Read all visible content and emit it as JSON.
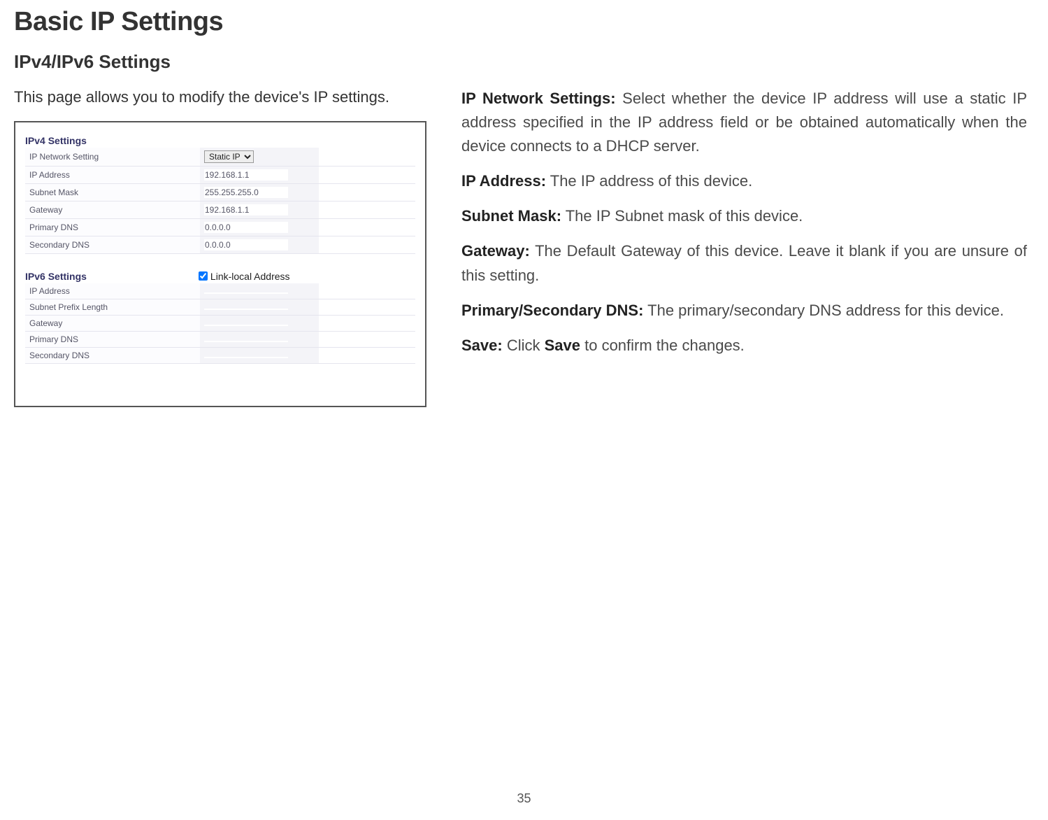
{
  "title": "Basic IP Settings",
  "subtitle": "IPv4/IPv6 Settings",
  "intro": "This page allows you to modify the device's IP settings.",
  "ipv4": {
    "heading": "IPv4 Settings",
    "rows": [
      {
        "label": "IP Network Setting",
        "type": "select",
        "value": "Static IP"
      },
      {
        "label": "IP Address",
        "value": "192.168.1.1"
      },
      {
        "label": "Subnet Mask",
        "value": "255.255.255.0"
      },
      {
        "label": "Gateway",
        "value": "192.168.1.1"
      },
      {
        "label": "Primary DNS",
        "value": "0.0.0.0"
      },
      {
        "label": "Secondary DNS",
        "value": "0.0.0.0"
      }
    ]
  },
  "ipv6": {
    "heading": "IPv6 Settings",
    "checkbox_label": "Link-local Address",
    "checkbox_checked": true,
    "rows": [
      {
        "label": "IP Address",
        "value": ""
      },
      {
        "label": "Subnet Prefix Length",
        "value": ""
      },
      {
        "label": "Gateway",
        "value": ""
      },
      {
        "label": "Primary DNS",
        "value": ""
      },
      {
        "label": "Secondary DNS",
        "value": ""
      }
    ]
  },
  "descriptions": {
    "ip_network_settings": {
      "term": "IP Network Settings:",
      "text": " Select whether the device IP address will use a static IP address specified in the IP address field or be obtained automatically when the device connects to a DHCP server."
    },
    "ip_address": {
      "term": "IP Address:",
      "text": " The IP address of this device."
    },
    "subnet_mask": {
      "term": "Subnet Mask:",
      "text": " The IP Subnet mask of this device."
    },
    "gateway": {
      "term": "Gateway:",
      "text": " The Default Gateway of this device. Leave it blank if you are unsure of this setting."
    },
    "dns": {
      "term": "Primary/Secondary DNS:",
      "text": " The primary/secondary DNS address for this device."
    },
    "save": {
      "term": "Save:",
      "pre": " Click ",
      "bold": "Save",
      "post": " to confirm the changes."
    }
  },
  "page_number": "35"
}
